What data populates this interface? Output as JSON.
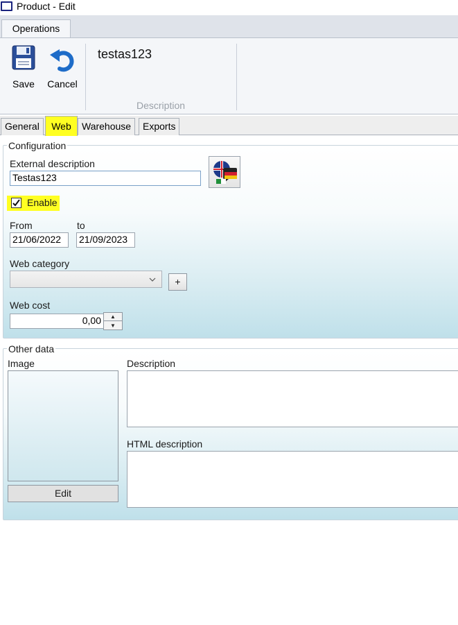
{
  "window": {
    "title": "Product - Edit",
    "icon": "window-icon"
  },
  "ribbon": {
    "tab": "Operations",
    "save_label": "Save",
    "cancel_label": "Cancel",
    "description_value": "testas123",
    "description_group_label": "Description"
  },
  "tabs": [
    {
      "label": "General",
      "active": false
    },
    {
      "label": "Web",
      "active": true
    },
    {
      "label": "Warehouse",
      "active": false
    },
    {
      "label": "Exports",
      "active": false
    }
  ],
  "configuration": {
    "title": "Configuration",
    "external_description_label": "External description",
    "external_description_value": "Testas123",
    "enable_label": "Enable",
    "enable_checked": true,
    "from_label": "From",
    "from_value": "21/06/2022",
    "to_label": "to",
    "to_value": "21/09/2023",
    "web_category_label": "Web category",
    "web_category_value": "",
    "add_category_label": "+",
    "web_cost_label": "Web cost",
    "web_cost_value": "0,00"
  },
  "other_data": {
    "title": "Other data",
    "image_label": "Image",
    "edit_label": "Edit",
    "description_label": "Description",
    "html_description_label": "HTML description"
  },
  "colors": {
    "highlight": "#ffff22",
    "accent_blue": "#1e6cc8"
  }
}
